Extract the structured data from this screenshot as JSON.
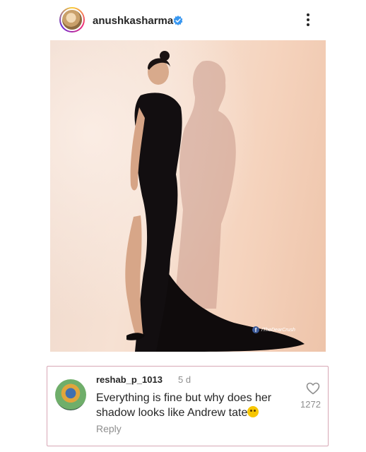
{
  "post": {
    "username": "anushkasharma",
    "verified": true,
    "icons": {
      "avatar": "profile-photo",
      "verified": "verified-badge-icon",
      "more": "more-options-icon"
    },
    "image": {
      "description_icon": "post-photo",
      "watermark": "/TheDearCrush"
    }
  },
  "comment": {
    "username": "reshab_p_1013",
    "time": "5 d",
    "text": "Everything is fine but why does her shadow looks like Andrew tate",
    "emoji": "thinking-face-emoji",
    "reply_label": "Reply",
    "likes": "1272",
    "border_color": "#d7a7b5"
  },
  "colors": {
    "verified": "#3897f0",
    "text": "#262626",
    "muted": "#8e8e8e"
  }
}
